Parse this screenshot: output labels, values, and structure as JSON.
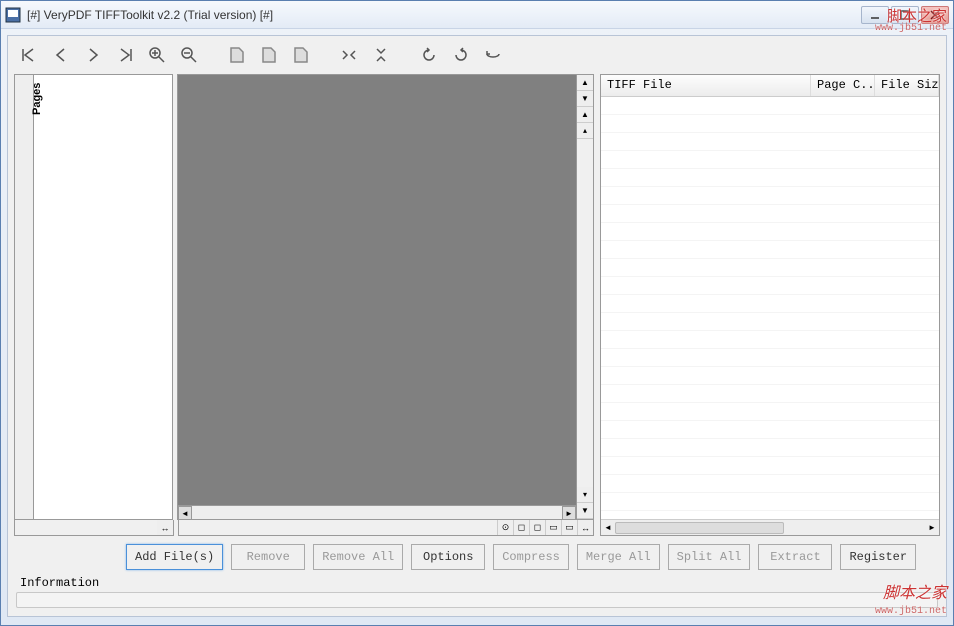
{
  "window": {
    "title": "[#] VeryPDF TIFFToolkit v2.2 (Trial version) [#]"
  },
  "pages_tab": "Pages",
  "list": {
    "columns": {
      "file": "TIFF File",
      "page_count": "Page C...",
      "file_size": "File Siz"
    }
  },
  "buttons": {
    "add_files": "Add File(s)",
    "remove": "Remove",
    "remove_all": "Remove All",
    "options": "Options",
    "compress": "Compress",
    "merge_all": "Merge All",
    "split_all": "Split All",
    "extract": "Extract",
    "register": "Register"
  },
  "status": {
    "label": "Information"
  },
  "watermark": {
    "line1": "脚本之家",
    "line2": "www.jb51.net",
    "line3": "脚本之家",
    "line4": "www.jb51.net"
  }
}
